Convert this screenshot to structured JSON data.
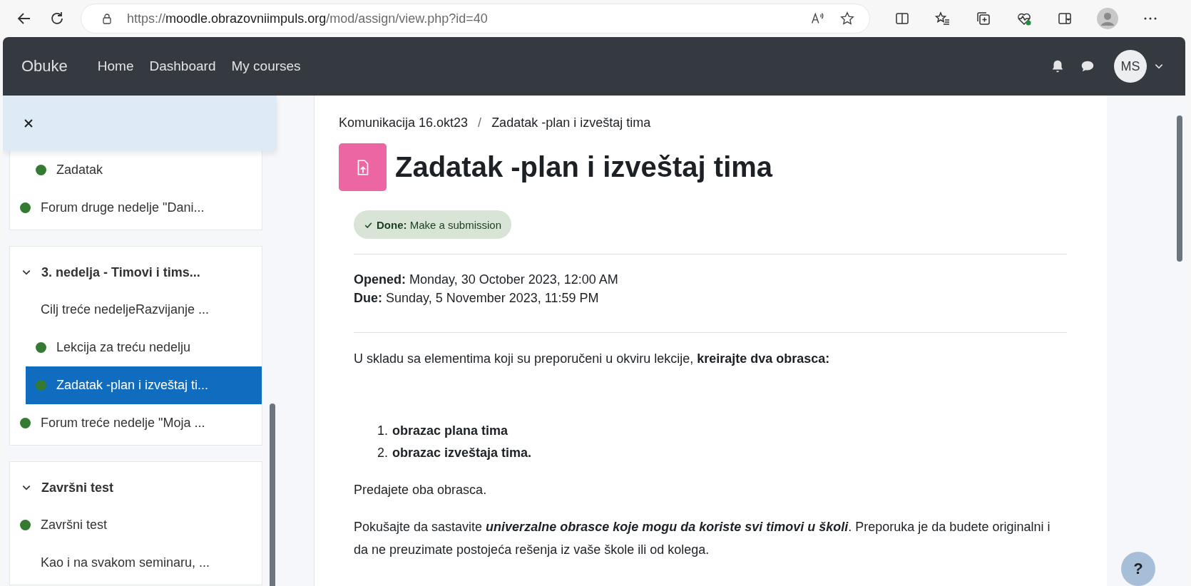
{
  "browser": {
    "url": {
      "scheme": "https://",
      "host": "moodle.obrazovniimpuls.org",
      "path": "/mod/assign/view.php?id=40"
    }
  },
  "navbar": {
    "brand": "Obuke",
    "links": [
      "Home",
      "Dashboard",
      "My courses"
    ],
    "user_initials": "MS"
  },
  "course_index": {
    "sections": [
      {
        "items": [
          {
            "kind": "activity",
            "title": "Zadatak",
            "indented": true,
            "selected": false
          },
          {
            "kind": "activity",
            "title": "Forum druge nedelje \"Dani...",
            "indented": false,
            "selected": false
          }
        ]
      },
      {
        "title": "3. nedelja - Timovi i tims...",
        "expanded": true,
        "items": [
          {
            "kind": "label",
            "title": "Cilj treće nedeljeRazvijanje ...",
            "indented": false,
            "selected": false
          },
          {
            "kind": "activity",
            "title": "Lekcija za treću nedelju",
            "indented": true,
            "selected": false
          },
          {
            "kind": "activity",
            "title": "Zadatak -plan i izveštaj ti...",
            "indented": true,
            "selected": true
          },
          {
            "kind": "activity",
            "title": "Forum treće nedelje \"Moja ...",
            "indented": false,
            "selected": false
          }
        ]
      },
      {
        "title": "Završni test",
        "expanded": true,
        "items": [
          {
            "kind": "activity",
            "title": "Završni test",
            "indented": false,
            "selected": false
          },
          {
            "kind": "label",
            "title": "Kao i na svakom seminaru, ...",
            "indented": false,
            "selected": false
          }
        ]
      }
    ]
  },
  "breadcrumb": [
    "Komunikacija 16.okt23",
    "Zadatak -plan i izveštaj tima"
  ],
  "breadcrumb_separator": "/",
  "page_title": "Zadatak -plan i izveštaj tima",
  "completion": {
    "done": true,
    "label": "Done:",
    "text": "Make a submission"
  },
  "dates": [
    {
      "label": "Opened:",
      "value": "Monday, 30 October 2023, 12:00 AM"
    },
    {
      "label": "Due:",
      "value": "Sunday, 5 November 2023, 11:59 PM"
    }
  ],
  "description": {
    "intro": "U skladu sa elementima koji su preporučeni u okviru lekcije, **kreirajte dva obrasca:**",
    "list": [
      {
        "number": "1.",
        "text": "obrazac plana tima"
      },
      {
        "number": "2.",
        "text": "obrazac izveštaja tima."
      }
    ],
    "paragraphs": [
      [
        {
          "text": "Predajete oba obrasca.",
          "emphasis": false
        }
      ],
      [
        {
          "text": "Pokušajte da sastavite ",
          "emphasis": false
        },
        {
          "text": "univerzalne obrasce koje mogu da koriste svi timovi u školi",
          "emphasis": true
        },
        {
          "text": ". Preporuka je da budete originalni i da ne preuzimate postojeća rešenja iz vaše škole ili od kolega.",
          "emphasis": false
        }
      ]
    ]
  },
  "help_button": "?"
}
